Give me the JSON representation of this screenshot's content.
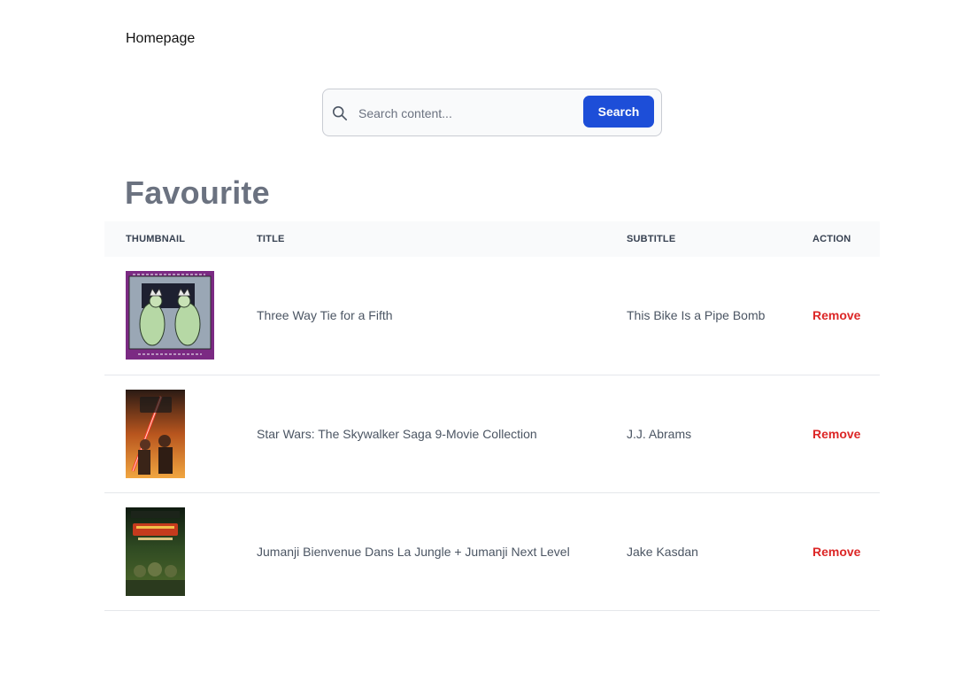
{
  "nav": {
    "home_label": "Homepage"
  },
  "search": {
    "placeholder": "Search content...",
    "value": "",
    "button_label": "Search"
  },
  "page": {
    "title": "Favourite"
  },
  "table": {
    "headers": {
      "thumbnail": "THUMBNAIL",
      "title": "TITLE",
      "subtitle": "SUBTITLE",
      "action": "ACTION"
    },
    "rows": [
      {
        "thumbnail": "album-cover-this-bike-is-a-pipe-bomb",
        "title": "Three Way Tie for a Fifth",
        "subtitle": "This Bike Is a Pipe Bomb",
        "action": "Remove"
      },
      {
        "thumbnail": "poster-star-wars",
        "title": "Star Wars: The Skywalker Saga 9-Movie Collection",
        "subtitle": "J.J. Abrams",
        "action": "Remove"
      },
      {
        "thumbnail": "poster-jumanji",
        "title": "Jumanji Bienvenue Dans La Jungle + Jumanji Next Level",
        "subtitle": "Jake Kasdan",
        "action": "Remove"
      }
    ]
  },
  "colors": {
    "accent": "#1d4ed8",
    "danger": "#dc2626",
    "heading": "#6b7280"
  }
}
